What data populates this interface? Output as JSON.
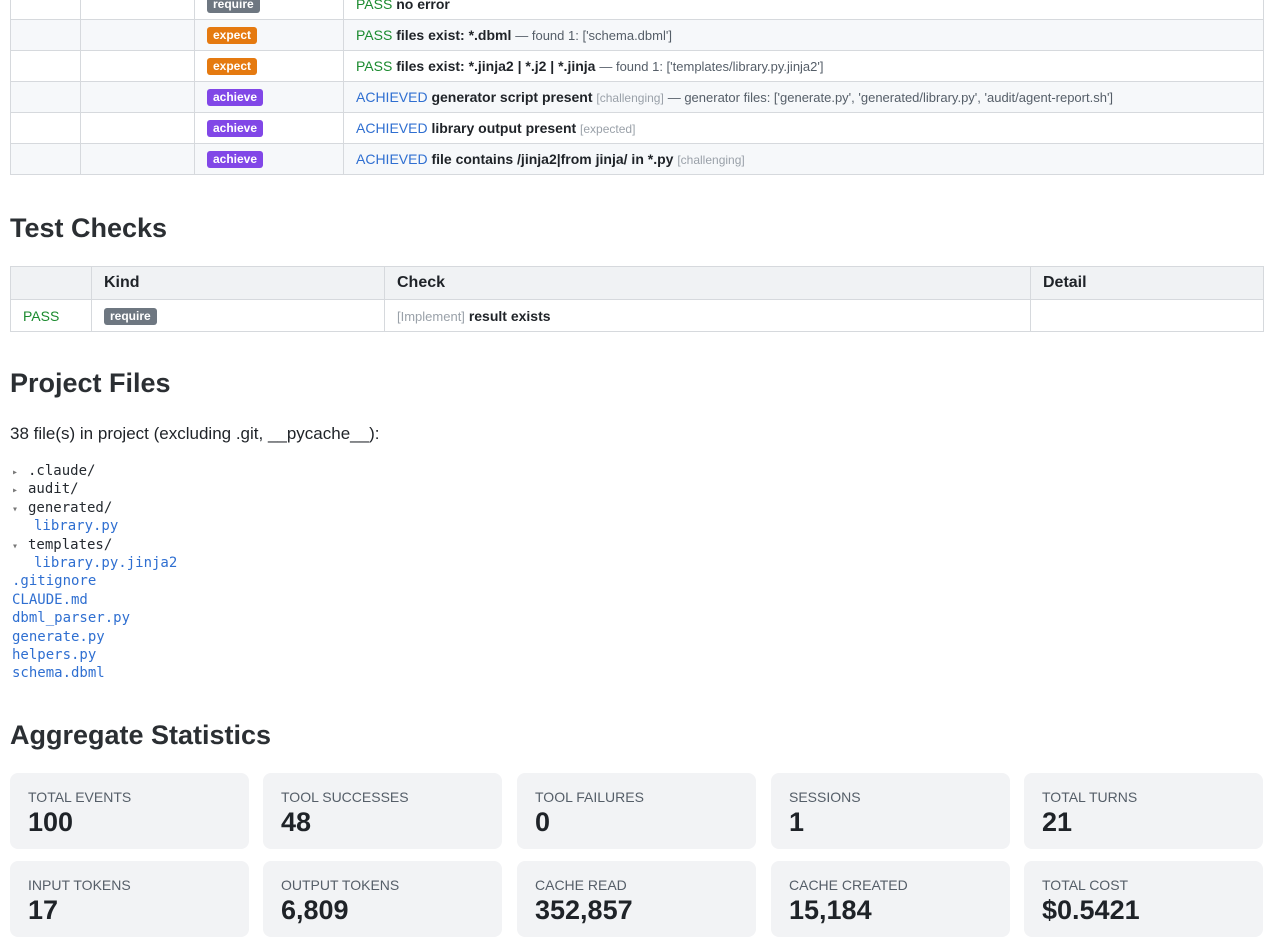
{
  "criteria": [
    {
      "badge": "require",
      "badge_class": "b-require",
      "status": "PASS",
      "status_class": "st-pass",
      "name": "no error",
      "note": "",
      "tag": ""
    },
    {
      "badge": "expect",
      "badge_class": "b-expect",
      "status": "PASS",
      "status_class": "st-pass",
      "name": "files exist: *.dbml",
      "note": "— found 1: ['schema.dbml']",
      "tag": ""
    },
    {
      "badge": "expect",
      "badge_class": "b-expect",
      "status": "PASS",
      "status_class": "st-pass",
      "name": "files exist: *.jinja2 | *.j2 | *.jinja",
      "note": "— found 1: ['templates/library.py.jinja2']",
      "tag": ""
    },
    {
      "badge": "achieve",
      "badge_class": "b-achieve",
      "status": "ACHIEVED",
      "status_class": "st-ach",
      "name": "generator script present",
      "tag": "[challenging]",
      "note": "— generator files: ['generate.py', 'generated/library.py', 'audit/agent-report.sh']"
    },
    {
      "badge": "achieve",
      "badge_class": "b-achieve",
      "status": "ACHIEVED",
      "status_class": "st-ach",
      "name": "library output present",
      "tag": "[expected]",
      "note": ""
    },
    {
      "badge": "achieve",
      "badge_class": "b-achieve",
      "status": "ACHIEVED",
      "status_class": "st-ach",
      "name": "file contains /jinja2|from jinja/ in *.py",
      "tag": "[challenging]",
      "note": ""
    }
  ],
  "test_checks": {
    "heading": "Test Checks",
    "columns": [
      "",
      "Kind",
      "Check",
      "Detail"
    ],
    "rows": [
      {
        "status": "PASS",
        "kind": "require",
        "phase": "[Implement]",
        "check": "result exists",
        "detail": ""
      }
    ]
  },
  "project_files": {
    "heading": "Project Files",
    "summary": "38 file(s) in project (excluding .git, __pycache__):",
    "tree": [
      {
        "type": "dir",
        "name": ".claude/",
        "open": false,
        "tri": "▸"
      },
      {
        "type": "dir",
        "name": "audit/",
        "open": false,
        "tri": "▸"
      },
      {
        "type": "dir",
        "name": "generated/",
        "open": true,
        "tri": "▾"
      },
      {
        "type": "file",
        "name": "library.py",
        "indent": true
      },
      {
        "type": "dir",
        "name": "templates/",
        "open": true,
        "tri": "▾"
      },
      {
        "type": "file",
        "name": "library.py.jinja2",
        "indent": true
      },
      {
        "type": "file",
        "name": ".gitignore"
      },
      {
        "type": "file",
        "name": "CLAUDE.md"
      },
      {
        "type": "file",
        "name": "dbml_parser.py"
      },
      {
        "type": "file",
        "name": "generate.py"
      },
      {
        "type": "file",
        "name": "helpers.py"
      },
      {
        "type": "file",
        "name": "schema.dbml"
      }
    ]
  },
  "aggregate": {
    "heading": "Aggregate Statistics",
    "stats": [
      {
        "label": "TOTAL EVENTS",
        "value": "100"
      },
      {
        "label": "TOOL SUCCESSES",
        "value": "48"
      },
      {
        "label": "TOOL FAILURES",
        "value": "0"
      },
      {
        "label": "SESSIONS",
        "value": "1"
      },
      {
        "label": "TOTAL TURNS",
        "value": "21"
      },
      {
        "label": "INPUT TOKENS",
        "value": "17"
      },
      {
        "label": "OUTPUT TOKENS",
        "value": "6,809"
      },
      {
        "label": "CACHE READ",
        "value": "352,857"
      },
      {
        "label": "CACHE CREATED",
        "value": "15,184"
      },
      {
        "label": "TOTAL COST",
        "value": "$0.5421"
      }
    ]
  }
}
